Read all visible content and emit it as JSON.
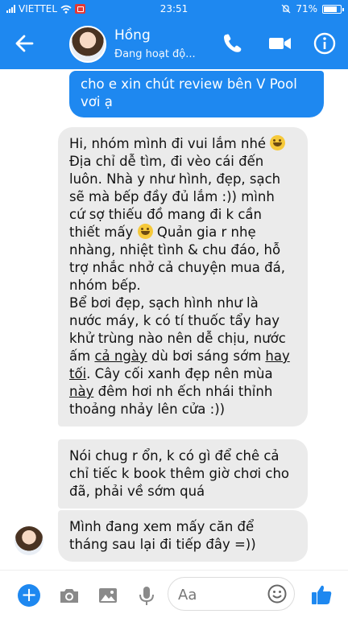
{
  "status_bar": {
    "carrier": "VIETTEL",
    "time": "23:51",
    "battery": "71%"
  },
  "header": {
    "contact_name": "Hồng",
    "contact_status": "Đang hoạt độ..."
  },
  "messages": {
    "outgoing": {
      "lines": [
        "cho e xin chút review bên V Pool",
        "vơi ạ"
      ]
    },
    "incoming": [
      {
        "lines": [
          "Hi, nhóm mình đi vui lắm nhé",
          "Địa chỉ dễ tìm, đi vèo cái đến",
          "luôn. Nhà y như hình, đẹp, sạch",
          "sẽ mà bếp đầy đủ lắm :)) mình",
          "cứ sợ thiếu đồ mang đi k cần",
          "thiết mấy",
          "Quản gia r nhẹ",
          "nhàng, nhiệt tình & chu đáo, hỗ",
          "trợ nhắc nhở cả chuyện mua đá,",
          "nhóm bếp.",
          "Bể bơi đẹp, sạch hình như là",
          "nước máy, k có tí thuốc tẩy hay",
          "khử trùng nào nên dễ chịu, nước",
          "ấm",
          "cả ngày",
          "dù bơi sáng sớm",
          "hay",
          "tối",
          ". Cây cối xanh đẹp nên mùa",
          "này",
          "đêm hơi nh ếch nhái thỉnh",
          "thoảng nhảy lên cửa :))"
        ]
      },
      {
        "lines": [
          "Nói chug r ổn, k có gì để chê cả",
          "chỉ tiếc k book thêm giờ chơi cho",
          "đã, phải về sớm quá"
        ]
      },
      {
        "lines": [
          "Mình đang xem mấy căn để",
          "tháng sau lại đi tiếp đây =))"
        ]
      }
    ]
  },
  "composer": {
    "placeholder": "Aa"
  },
  "colors": {
    "brand": "#1e88f0",
    "incoming_bubble": "#ebebeb"
  },
  "icons": {
    "back": "arrow-left-icon",
    "call": "phone-icon",
    "video": "video-camera-icon",
    "info": "info-icon",
    "plus": "plus-icon",
    "camera": "camera-icon",
    "gallery": "image-icon",
    "mic": "microphone-icon",
    "emoji": "smiley-icon",
    "like": "thumbs-up-icon"
  }
}
